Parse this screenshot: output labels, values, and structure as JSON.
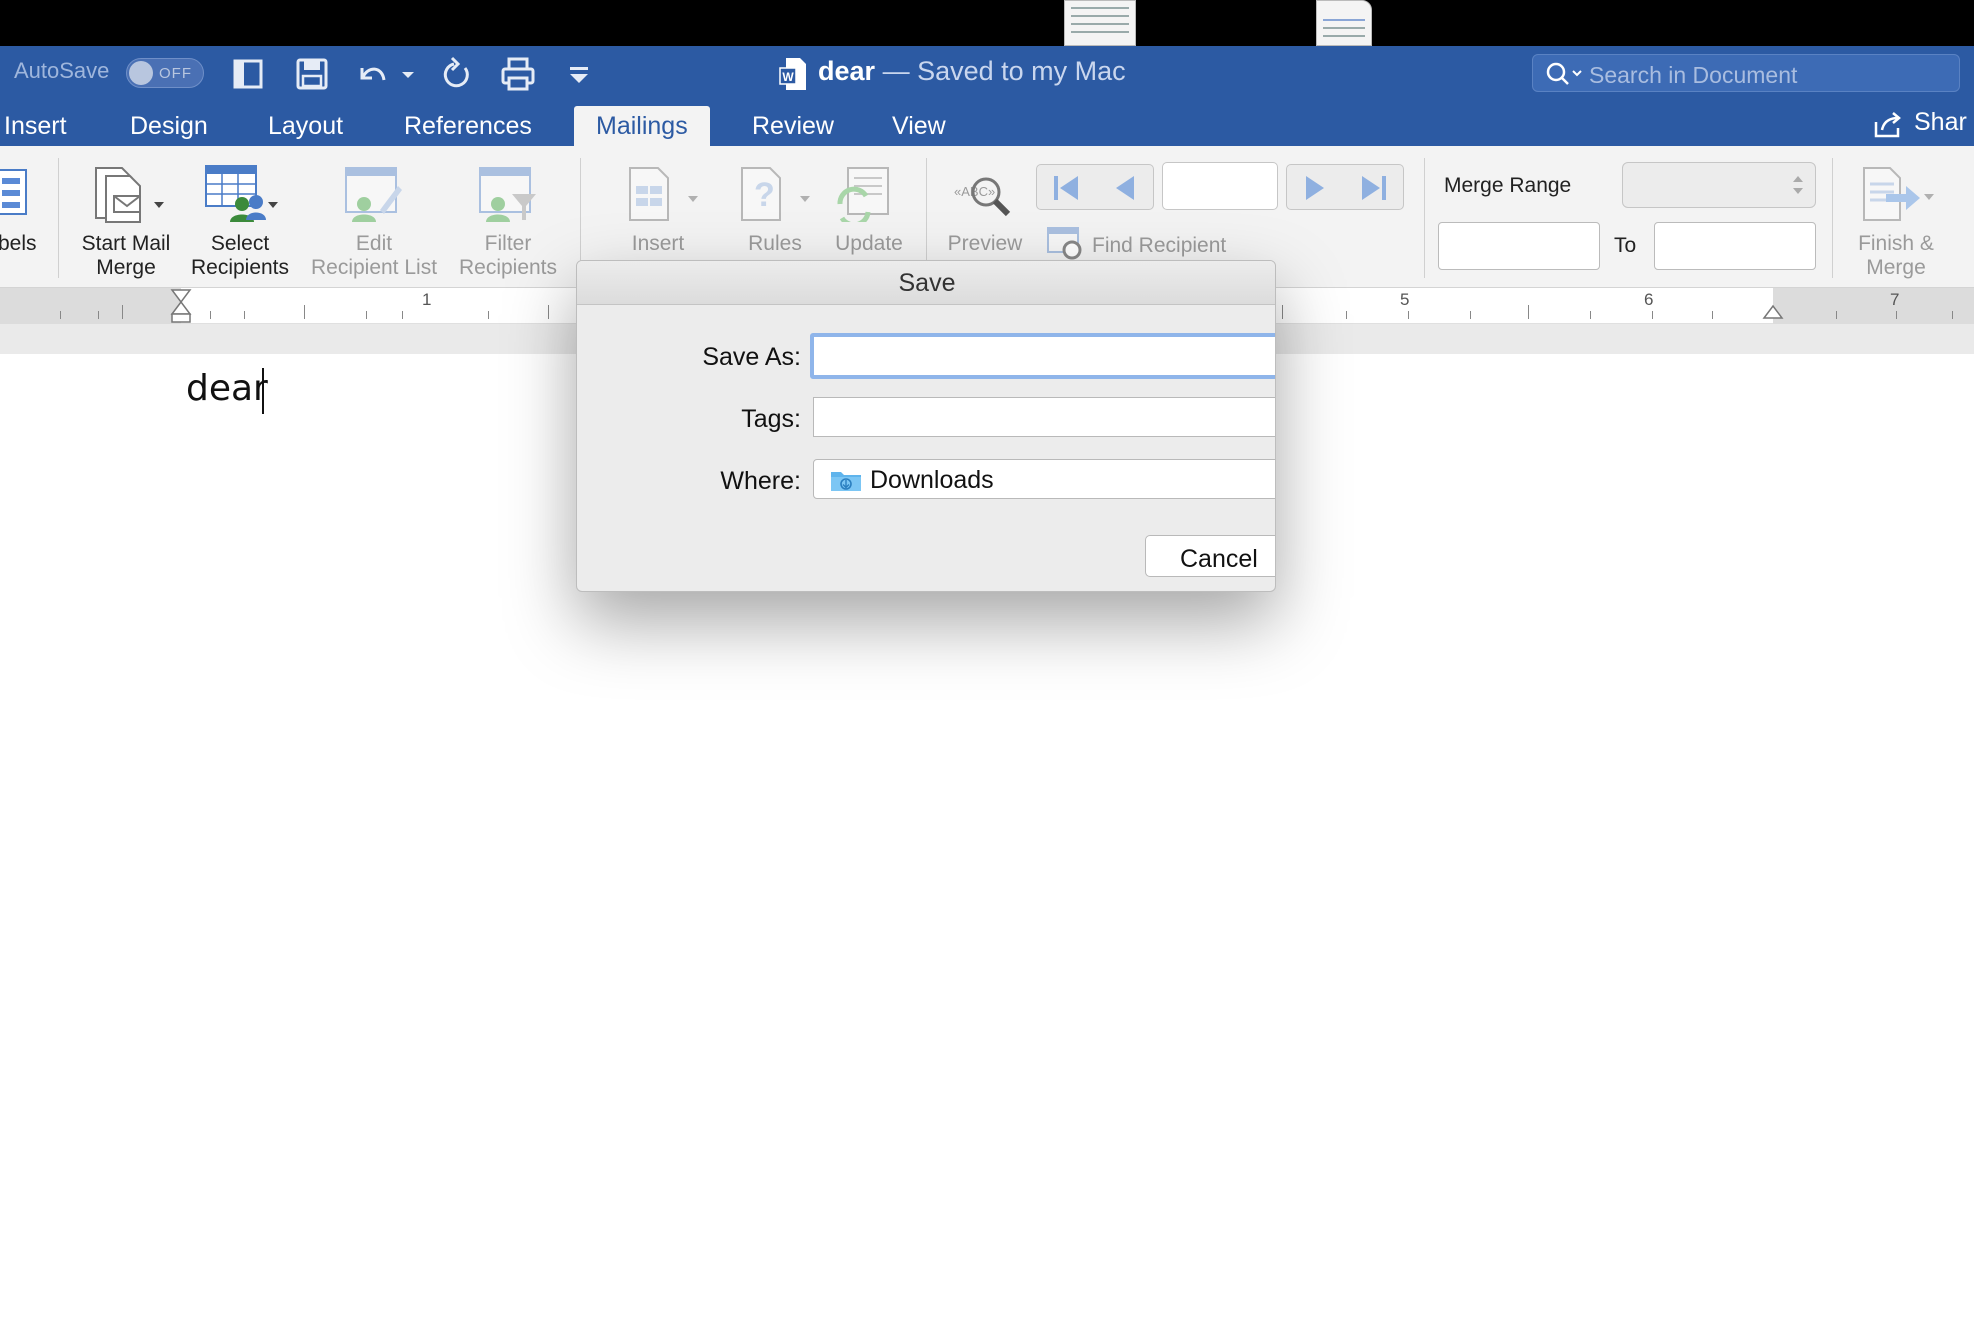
{
  "titlebar": {
    "autosave_label": "AutoSave",
    "autosave_state": "OFF",
    "doc_name": "dear",
    "doc_status": "— Saved to my Mac",
    "search_placeholder": "Search in Document"
  },
  "tabs": [
    {
      "label": "Insert"
    },
    {
      "label": "Design"
    },
    {
      "label": "Layout"
    },
    {
      "label": "References"
    },
    {
      "label": "Mailings"
    },
    {
      "label": "Review"
    },
    {
      "label": "View"
    }
  ],
  "share_label": "Shar",
  "ribbon": {
    "labels_partial": "bels",
    "start_mail_merge": [
      "Start Mail",
      "Merge"
    ],
    "select_recipients": [
      "Select",
      "Recipients"
    ],
    "edit_recipient_list": [
      "Edit",
      "Recipient List"
    ],
    "filter_recipients": [
      "Filter",
      "Recipients"
    ],
    "insert": "Insert",
    "rules": "Rules",
    "update": "Update",
    "preview": "Preview",
    "find_recipient": "Find Recipient",
    "merge_range": "Merge Range",
    "to": "To",
    "finish_merge": [
      "Finish &",
      "Merge"
    ]
  },
  "ruler": {
    "numbers": [
      "1",
      "5",
      "6",
      "7"
    ]
  },
  "document": {
    "text": "dear"
  },
  "save_dialog": {
    "title": "Save",
    "save_as_label": "Save As:",
    "save_as_value": "",
    "tags_label": "Tags:",
    "tags_value": "",
    "where_label": "Where:",
    "where_value": "Downloads",
    "cancel_label": "Cancel"
  },
  "colors": {
    "accent": "#2c5aa3",
    "focus_ring": "#8fb5ea"
  }
}
